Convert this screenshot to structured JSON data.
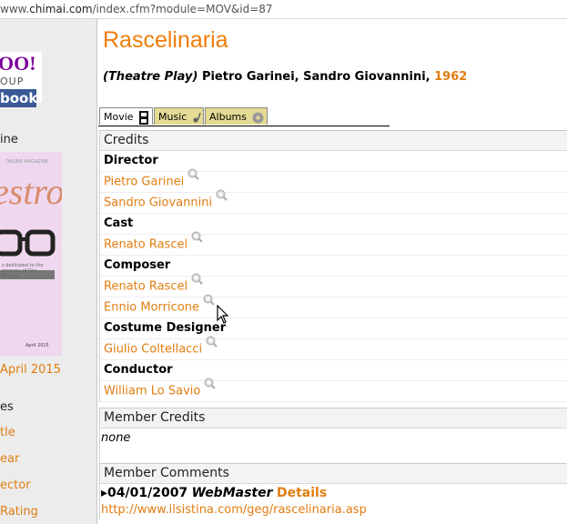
{
  "browser": {
    "url_prefix": "www.",
    "url_host": "chimai.com",
    "url_path": "/index.cfm?module=MOV&id=87"
  },
  "sidebar": {
    "yahoo_logo": "OO!",
    "yahoo_sub": "OUP",
    "facebook_logo": "book",
    "line_label": "ine",
    "magazine": {
      "top": "ONLINE MAGAZINE",
      "title": "estro",
      "note": "s dedicated to the memory of Don Thomas",
      "date": "April 2015"
    },
    "issue_link": "April 2015",
    "heading": "es",
    "links": [
      "tle",
      "ear",
      "ector",
      "Rating"
    ]
  },
  "page": {
    "title": "Rascelinaria",
    "type": "(Theatre Play)",
    "authors": "Pietro Garinei, Sandro Giovannini,",
    "year": "1962"
  },
  "tabs": [
    {
      "label": "Movie",
      "icon": "film-icon"
    },
    {
      "label": "Music",
      "icon": "note-icon"
    },
    {
      "label": "Albums",
      "icon": "disc-icon"
    }
  ],
  "credits": {
    "header": "Credits",
    "groups": [
      {
        "role": "Director",
        "people": [
          "Pietro Garinei",
          "Sandro Giovannini"
        ]
      },
      {
        "role": "Cast",
        "people": [
          "Renato Rascel"
        ]
      },
      {
        "role": "Composer",
        "people": [
          "Renato Rascel",
          "Ennio Morricone"
        ]
      },
      {
        "role": "Costume Designer",
        "people": [
          "Giulio Coltellacci"
        ]
      },
      {
        "role": "Conductor",
        "people": [
          "William Lo Savio"
        ]
      }
    ]
  },
  "member_credits": {
    "header": "Member Credits",
    "value": "none"
  },
  "member_comments": {
    "header": "Member Comments",
    "date": "04/01/2007",
    "user": "WebMaster",
    "details": "Details",
    "url": "http://www.ilsistina.com/geg/rascelinaria.asp"
  },
  "colors": {
    "accent": "#f07d0a",
    "tab_inactive": "#e4dc94",
    "facebook": "#3b5998"
  }
}
